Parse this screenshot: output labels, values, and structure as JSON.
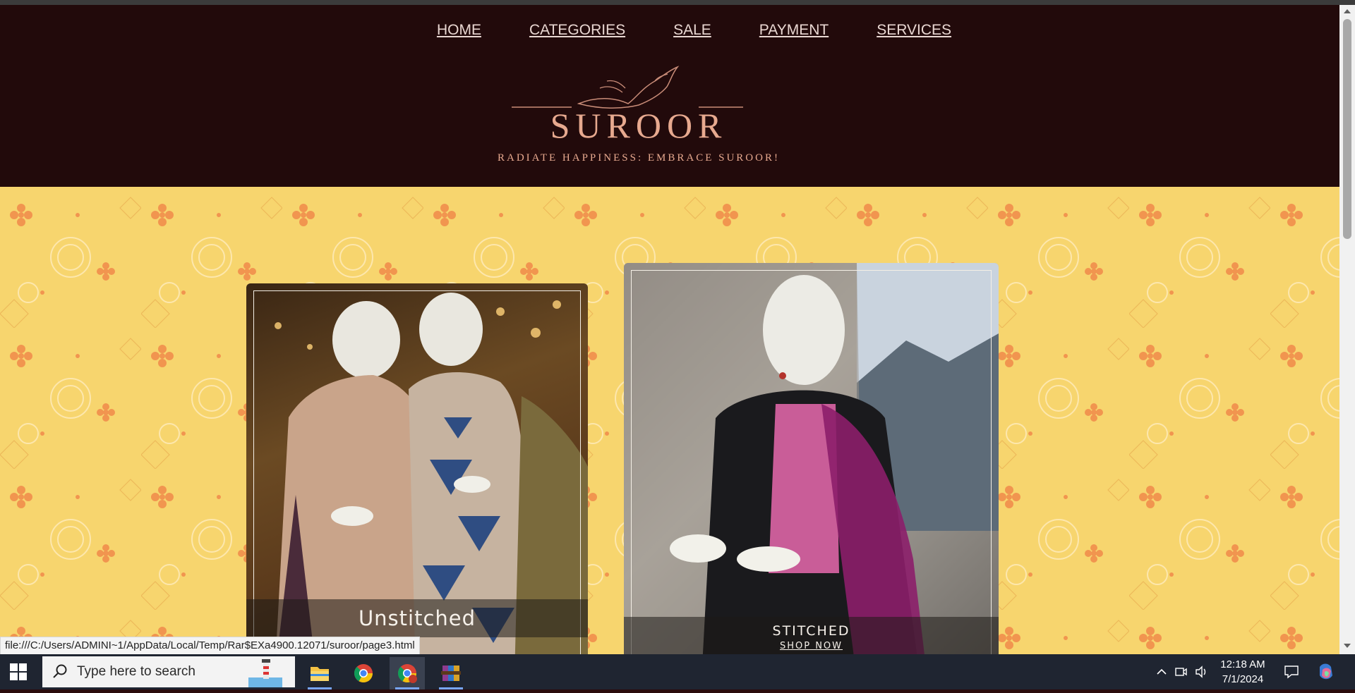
{
  "nav": {
    "items": [
      {
        "label": "HOME"
      },
      {
        "label": "CATEGORIES"
      },
      {
        "label": "SALE"
      },
      {
        "label": "PAYMENT"
      },
      {
        "label": "SERVICES"
      }
    ]
  },
  "logo": {
    "name": "SUROOR",
    "tagline": "RADIATE HAPPINESS: EMBRACE SUROOR!"
  },
  "cards": [
    {
      "title": "Unstitched"
    },
    {
      "title": "STITCHED",
      "cta": "SHOP NOW"
    }
  ],
  "status_bar": {
    "url": "file:///C:/Users/ADMINI~1/AppData/Local/Temp/Rar$EXa4900.12071/suroor/page3.html"
  },
  "taskbar": {
    "search_placeholder": "Type here to search",
    "time": "12:18 AM",
    "date": "7/1/2024",
    "apps": [
      "file-explorer-icon",
      "chrome-icon",
      "chrome-profile-icon",
      "winrar-icon"
    ]
  },
  "colors": {
    "header_bg": "#220a0b",
    "accent_logo": "#e7a98f",
    "page_bg": "#f7d56e",
    "pattern_orange": "#f08a4a"
  }
}
